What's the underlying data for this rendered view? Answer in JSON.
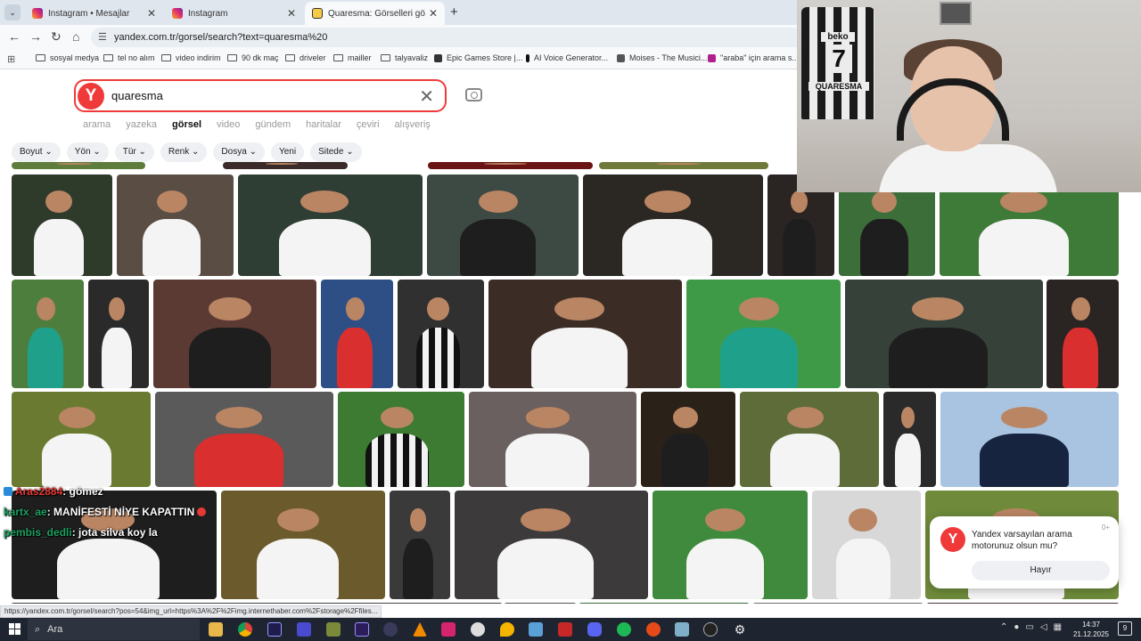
{
  "tabs": [
    {
      "title": "Instagram • Mesajlar",
      "favicon": "instagram-icon",
      "active": false
    },
    {
      "title": "Instagram",
      "favicon": "instagram-icon",
      "active": false
    },
    {
      "title": "Quaresma: Görselleri görüntüle",
      "favicon": "yandex-icon",
      "active": true
    }
  ],
  "address": {
    "url": "yandex.com.tr/gorsel/search?text=quaresma%20"
  },
  "bookmarks": [
    {
      "label": "sosyal medya",
      "icon": "folder-icon"
    },
    {
      "label": "tel no alım",
      "icon": "folder-icon"
    },
    {
      "label": "video indirim",
      "icon": "folder-icon"
    },
    {
      "label": "90 dk maç",
      "icon": "folder-icon"
    },
    {
      "label": "driveler",
      "icon": "folder-icon"
    },
    {
      "label": "mailler",
      "icon": "folder-icon"
    },
    {
      "label": "talyavaliz",
      "icon": "folder-icon"
    },
    {
      "label": "Epic Games Store |...",
      "icon": "epic-icon"
    },
    {
      "label": "AI Voice Generator...",
      "icon": "elevenlabs-icon"
    },
    {
      "label": "Moises - The Musici...",
      "icon": "moises-icon"
    },
    {
      "label": "\"araba\" için arama s...",
      "icon": "search-site-icon"
    }
  ],
  "search": {
    "logo": "Y",
    "query": "quaresma"
  },
  "services": [
    {
      "label": "arama",
      "active": false
    },
    {
      "label": "yazeka",
      "active": false
    },
    {
      "label": "görsel",
      "active": true
    },
    {
      "label": "video",
      "active": false
    },
    {
      "label": "gündem",
      "active": false
    },
    {
      "label": "haritalar",
      "active": false
    },
    {
      "label": "çeviri",
      "active": false
    },
    {
      "label": "alışveriş",
      "active": false
    }
  ],
  "filters": [
    "Boyut",
    "Yön",
    "Tür",
    "Renk",
    "Dosya",
    "Yeni",
    "Sitede"
  ],
  "filter_has_dropdown": [
    true,
    true,
    true,
    true,
    true,
    false,
    true
  ],
  "webcam": {
    "jersey_sponsor": "beko",
    "jersey_number": "7",
    "jersey_name": "QUARESMA"
  },
  "chat": [
    {
      "user": "Aras2884",
      "message": ": gömez",
      "user_color": "red"
    },
    {
      "user": "kartx_ae",
      "message": ": MANİFESTİ NİYE KAPATTIN",
      "user_color": "green",
      "badge": true
    },
    {
      "user": "pembis_dedli",
      "message": ": jota silva koy la",
      "user_color": "green"
    }
  ],
  "popup": {
    "logo": "Y",
    "text": "Yandex varsayılan arama motorunuz olsun mu?",
    "close": "0+",
    "button": "Hayır"
  },
  "status_url": "https://yandex.com.tr/gorsel/search?pos=54&img_url=https%3A%2F%2Fimg.internethaber.com%2Fstorage%2Ffiles...",
  "taskbar": {
    "search_placeholder": "Ara",
    "apps": [
      "file-explorer-icon",
      "chrome-icon",
      "after-effects-icon",
      "vpn-icon",
      "game-icon",
      "media-encoder-icon",
      "obs-icon",
      "vlc-icon",
      "capcut-icon",
      "browser-icon",
      "maps-icon",
      "store-icon",
      "app-icon",
      "discord-icon",
      "spotify-icon",
      "app-icon",
      "app-icon",
      "steam-icon",
      "settings-icon"
    ],
    "time": "14:37",
    "date": "21.12.2025",
    "notifications": "9"
  },
  "colors": {
    "yandex_red": "#f03a3a",
    "tab_bar": "#dfe6ee",
    "taskbar": "#1f2530"
  }
}
